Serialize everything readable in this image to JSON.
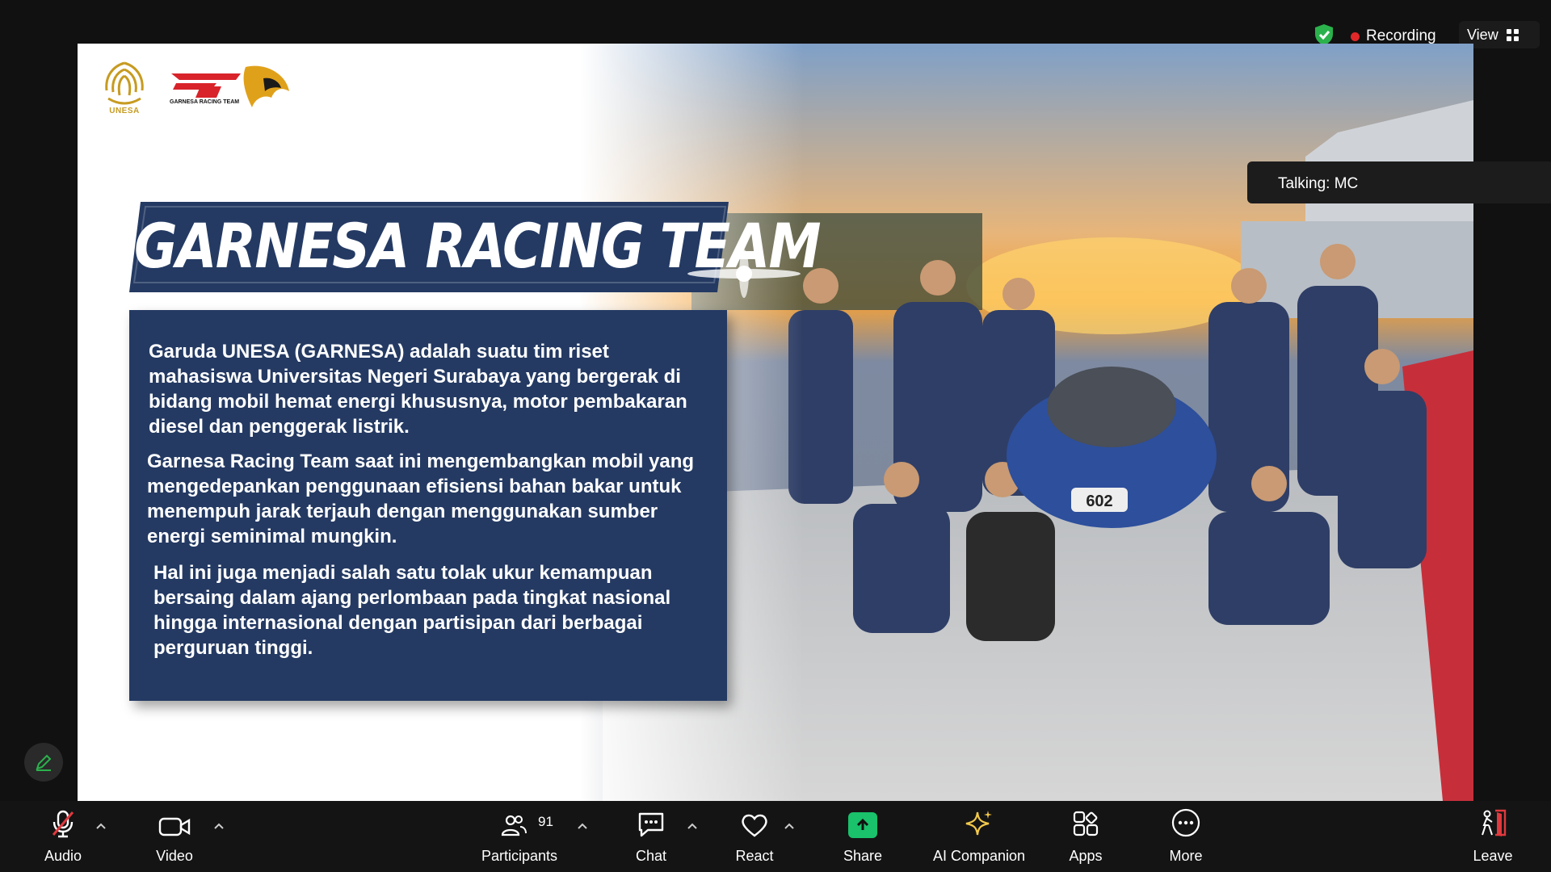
{
  "meeting": {
    "recording_label": "Recording",
    "view_label": "View",
    "talking_label": "Talking: MC"
  },
  "slide": {
    "logo_unesa_text": "UNESA",
    "logo_garnesa_text": "GARNESA RACING TEAM",
    "title": "GARNESA RACING TEAM",
    "paragraph1": "Garuda UNESA (GARNESA) adalah suatu tim riset mahasiswa Universitas Negeri Surabaya yang bergerak di bidang mobil hemat energi khususnya, motor pembakaran diesel dan penggerak listrik.",
    "paragraph2": "Garnesa Racing Team saat ini mengembangkan mobil yang mengedepankan penggunaan efisiensi bahan bakar untuk menempuh jarak terjauh dengan menggunakan sumber energi seminimal mungkin.",
    "paragraph3": "Hal ini juga menjadi salah satu tolak ukur kemampuan bersaing dalam ajang perlombaan pada tingkat nasional hingga internasional dengan partisipan dari berbagai perguruan tinggi.",
    "car_number": "602"
  },
  "toolbar": {
    "audio": "Audio",
    "video": "Video",
    "participants": "Participants",
    "participants_count": "91",
    "chat": "Chat",
    "react": "React",
    "share": "Share",
    "ai_companion": "AI Companion",
    "apps": "Apps",
    "more": "More",
    "leave": "Leave"
  },
  "colors": {
    "panel_navy": "#243a63",
    "share_green": "#19c26b",
    "recording_red": "#e02828",
    "shield_green": "#2bb24c",
    "leave_red": "#e0393e"
  }
}
